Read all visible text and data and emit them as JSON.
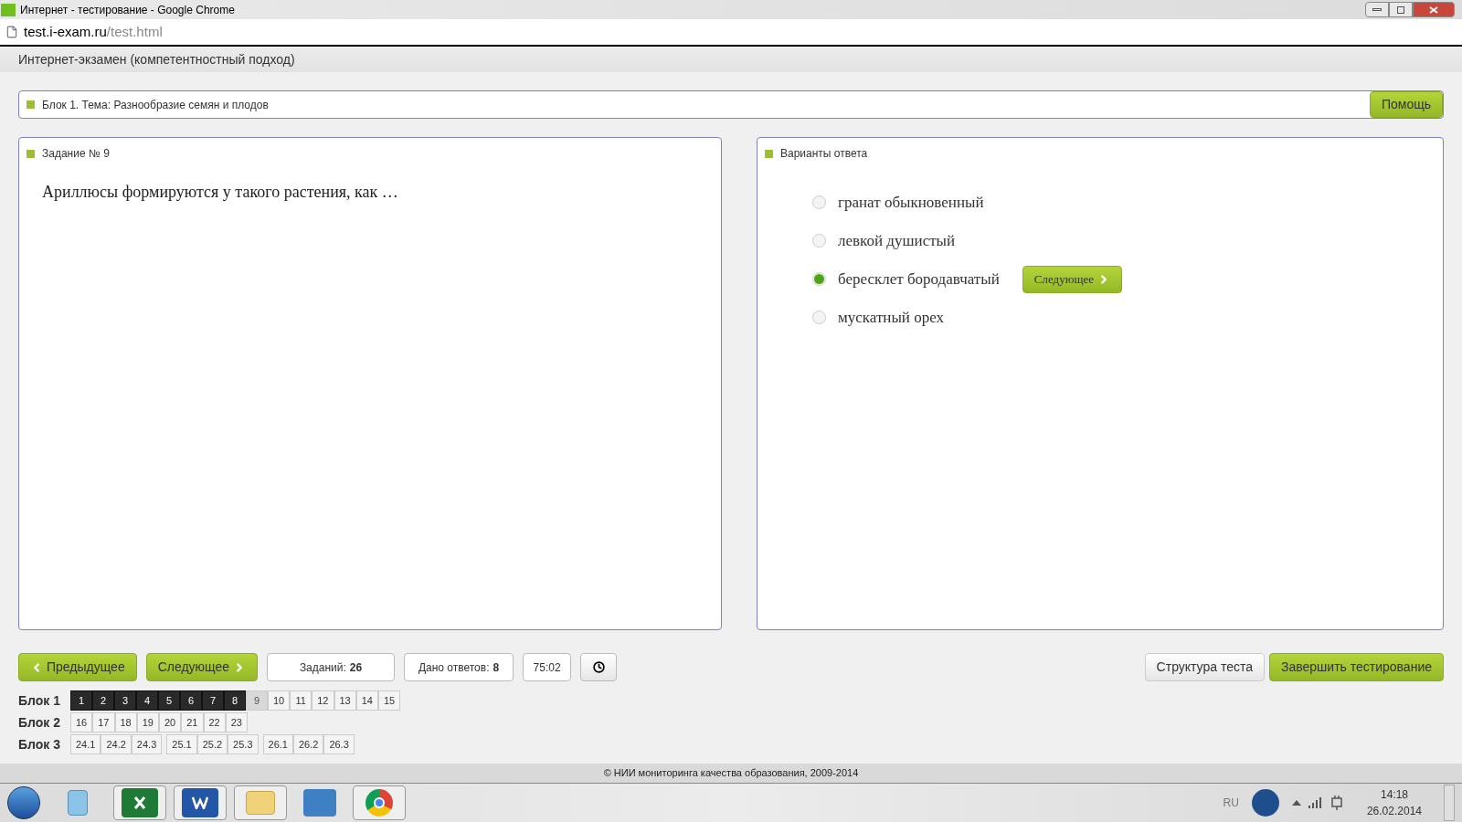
{
  "window": {
    "title": "Интернет - тестирование - Google Chrome"
  },
  "address_bar": {
    "host": "test.i-exam.ru",
    "path": "/test.html"
  },
  "header": {
    "title": "Интернет-экзамен (компетентностный подход)"
  },
  "block_bar": {
    "title": "Блок 1. Тема: Разнообразие семян и плодов",
    "help_button": "Помощь"
  },
  "question": {
    "heading": "Задание № 9",
    "text": "Ариллюсы формируются у такого растения, как …"
  },
  "answers": {
    "heading": "Варианты ответа",
    "next_button": "Следующее",
    "options": [
      {
        "label": "гранат обыкновенный",
        "selected": false
      },
      {
        "label": "левкой душистый",
        "selected": false
      },
      {
        "label": "бересклет бородавчатый",
        "selected": true
      },
      {
        "label": "мускатный орех",
        "selected": false
      }
    ]
  },
  "nav": {
    "prev_button": "Предыдущее",
    "next_button": "Следующее",
    "tasks_label": "Заданий:",
    "tasks_value": "26",
    "answered_label": "Дано ответов:",
    "answered_value": "8",
    "timer": "75:02",
    "structure_button": "Структура теста",
    "finish_button": "Завершить тестирование"
  },
  "blocks": [
    {
      "label": "Блок 1",
      "groups": [
        [
          {
            "label": "1",
            "answered": true,
            "selected": false
          },
          {
            "label": "2",
            "answered": true,
            "selected": false
          },
          {
            "label": "3",
            "answered": true,
            "selected": false
          },
          {
            "label": "4",
            "answered": true,
            "selected": false
          },
          {
            "label": "5",
            "answered": true,
            "selected": false
          },
          {
            "label": "6",
            "answered": true,
            "selected": false
          },
          {
            "label": "7",
            "answered": true,
            "selected": false
          },
          {
            "label": "8",
            "answered": true,
            "selected": false
          },
          {
            "label": "9",
            "answered": false,
            "selected": true
          },
          {
            "label": "10",
            "answered": false,
            "selected": false
          },
          {
            "label": "11",
            "answered": false,
            "selected": false
          },
          {
            "label": "12",
            "answered": false,
            "selected": false
          },
          {
            "label": "13",
            "answered": false,
            "selected": false
          },
          {
            "label": "14",
            "answered": false,
            "selected": false
          },
          {
            "label": "15",
            "answered": false,
            "selected": false
          }
        ]
      ]
    },
    {
      "label": "Блок 2",
      "groups": [
        [
          {
            "label": "16",
            "answered": false,
            "selected": false
          },
          {
            "label": "17",
            "answered": false,
            "selected": false
          },
          {
            "label": "18",
            "answered": false,
            "selected": false
          },
          {
            "label": "19",
            "answered": false,
            "selected": false
          },
          {
            "label": "20",
            "answered": false,
            "selected": false
          },
          {
            "label": "21",
            "answered": false,
            "selected": false
          },
          {
            "label": "22",
            "answered": false,
            "selected": false
          },
          {
            "label": "23",
            "answered": false,
            "selected": false
          }
        ]
      ]
    },
    {
      "label": "Блок 3",
      "groups": [
        [
          {
            "label": "24.1",
            "answered": false,
            "selected": false
          },
          {
            "label": "24.2",
            "answered": false,
            "selected": false
          },
          {
            "label": "24.3",
            "answered": false,
            "selected": false
          }
        ],
        [
          {
            "label": "25.1",
            "answered": false,
            "selected": false
          },
          {
            "label": "25.2",
            "answered": false,
            "selected": false
          },
          {
            "label": "25.3",
            "answered": false,
            "selected": false
          }
        ],
        [
          {
            "label": "26.1",
            "answered": false,
            "selected": false
          },
          {
            "label": "26.2",
            "answered": false,
            "selected": false
          },
          {
            "label": "26.3",
            "answered": false,
            "selected": false
          }
        ]
      ]
    }
  ],
  "footer": {
    "text": "© НИИ мониторинга качества образования, 2009-2014"
  },
  "taskbar": {
    "language": "RU",
    "time": "14:18",
    "date": "26.02.2014"
  }
}
